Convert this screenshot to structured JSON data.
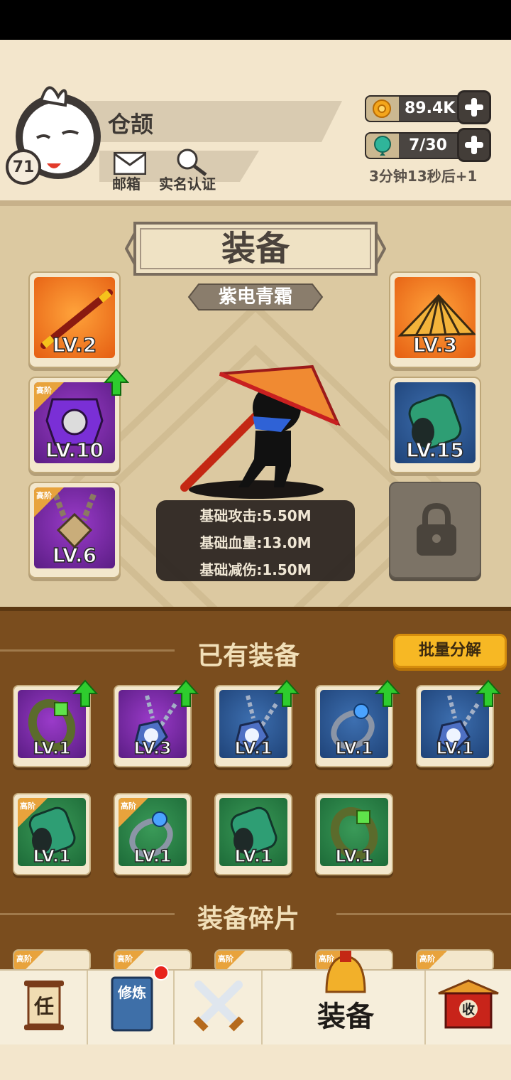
{
  "player": {
    "name": "仓颉",
    "level": "71"
  },
  "header_links": {
    "mail_label": "邮箱",
    "verify_label": "实名认证"
  },
  "resources": {
    "coins": "89.4K",
    "gems": "7/30",
    "regen_text": "3分钟13秒后+1"
  },
  "equipment": {
    "title": "装备",
    "set_name": "紫电青霜",
    "slots": [
      {
        "name": "staff",
        "level": "LV.2",
        "rarity": "orange",
        "tier": ""
      },
      {
        "name": "armor",
        "level": "LV.10",
        "rarity": "purple",
        "tier": "高阶"
      },
      {
        "name": "necklace",
        "level": "LV.6",
        "rarity": "purple",
        "tier": "高阶"
      },
      {
        "name": "hat",
        "level": "LV.3",
        "rarity": "orange",
        "tier": ""
      },
      {
        "name": "bracer",
        "level": "LV.15",
        "rarity": "blue",
        "tier": ""
      }
    ],
    "stats": [
      "基础攻击:5.50M",
      "基础血量:13.0M",
      "基础减伤:1.50M"
    ]
  },
  "owned": {
    "title": "已有装备",
    "batch_button": "批量分解",
    "items": [
      {
        "type": "bracelet",
        "level": "LV.1",
        "rarity": "purple",
        "upgrade": true,
        "tier": ""
      },
      {
        "type": "necklace",
        "level": "LV.3",
        "rarity": "purple",
        "upgrade": true,
        "tier": ""
      },
      {
        "type": "necklace",
        "level": "LV.1",
        "rarity": "blue",
        "upgrade": true,
        "tier": ""
      },
      {
        "type": "ring",
        "level": "LV.1",
        "rarity": "blue",
        "upgrade": true,
        "tier": ""
      },
      {
        "type": "necklace",
        "level": "LV.1",
        "rarity": "blue",
        "upgrade": true,
        "tier": ""
      },
      {
        "type": "bracer",
        "level": "LV.1",
        "rarity": "green",
        "upgrade": false,
        "tier": "高阶"
      },
      {
        "type": "ring",
        "level": "LV.1",
        "rarity": "green",
        "upgrade": false,
        "tier": "高阶"
      },
      {
        "type": "bracer",
        "level": "LV.1",
        "rarity": "green",
        "upgrade": false,
        "tier": ""
      },
      {
        "type": "bracelet",
        "level": "LV.1",
        "rarity": "green",
        "upgrade": false,
        "tier": ""
      }
    ]
  },
  "fragments": {
    "title": "装备碎片",
    "tiers": [
      "高阶",
      "高阶",
      "高阶",
      "高阶",
      "高阶"
    ]
  },
  "nav": {
    "quest_label": "任",
    "cultivate_label": "修炼",
    "equip_label": "装备",
    "shop_label": "收"
  },
  "colors": {
    "upgrade_arrow": "#2ecc2e",
    "batch_button": "#f7b824"
  }
}
